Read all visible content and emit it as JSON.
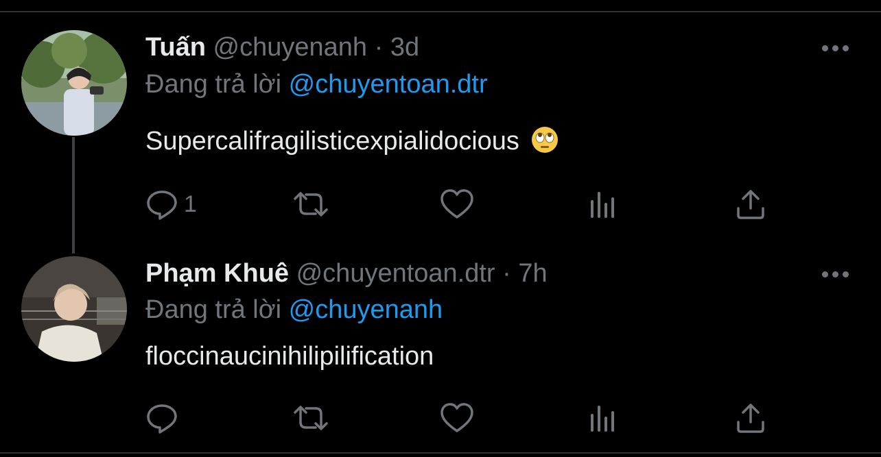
{
  "tweets": [
    {
      "name": "Tuấn",
      "handle": "@chuyenanh",
      "separator": "·",
      "time": "3d",
      "replying_prefix": "Đang trả lời",
      "replying_to": "@chuyentoan.dtr",
      "text": "Supercalifragilisticexpialidocious",
      "emoji": "face-with-rolling-eyes",
      "reply_count": "1",
      "actions": [
        "reply-icon",
        "retweet-icon",
        "like-icon",
        "views-icon",
        "share-icon"
      ]
    },
    {
      "name": "Phạm Khuê",
      "handle": "@chuyentoan.dtr",
      "separator": "·",
      "time": "7h",
      "replying_prefix": "Đang trả lời",
      "replying_to": "@chuyenanh",
      "text": "floccinaucinihilipilification",
      "reply_count": "",
      "actions": [
        "reply-icon",
        "retweet-icon",
        "like-icon",
        "views-icon",
        "share-icon"
      ]
    }
  ],
  "colors": {
    "background": "#000000",
    "primary_text": "#e7e9ea",
    "secondary_text": "#71767b",
    "accent": "#1d9bf0"
  }
}
